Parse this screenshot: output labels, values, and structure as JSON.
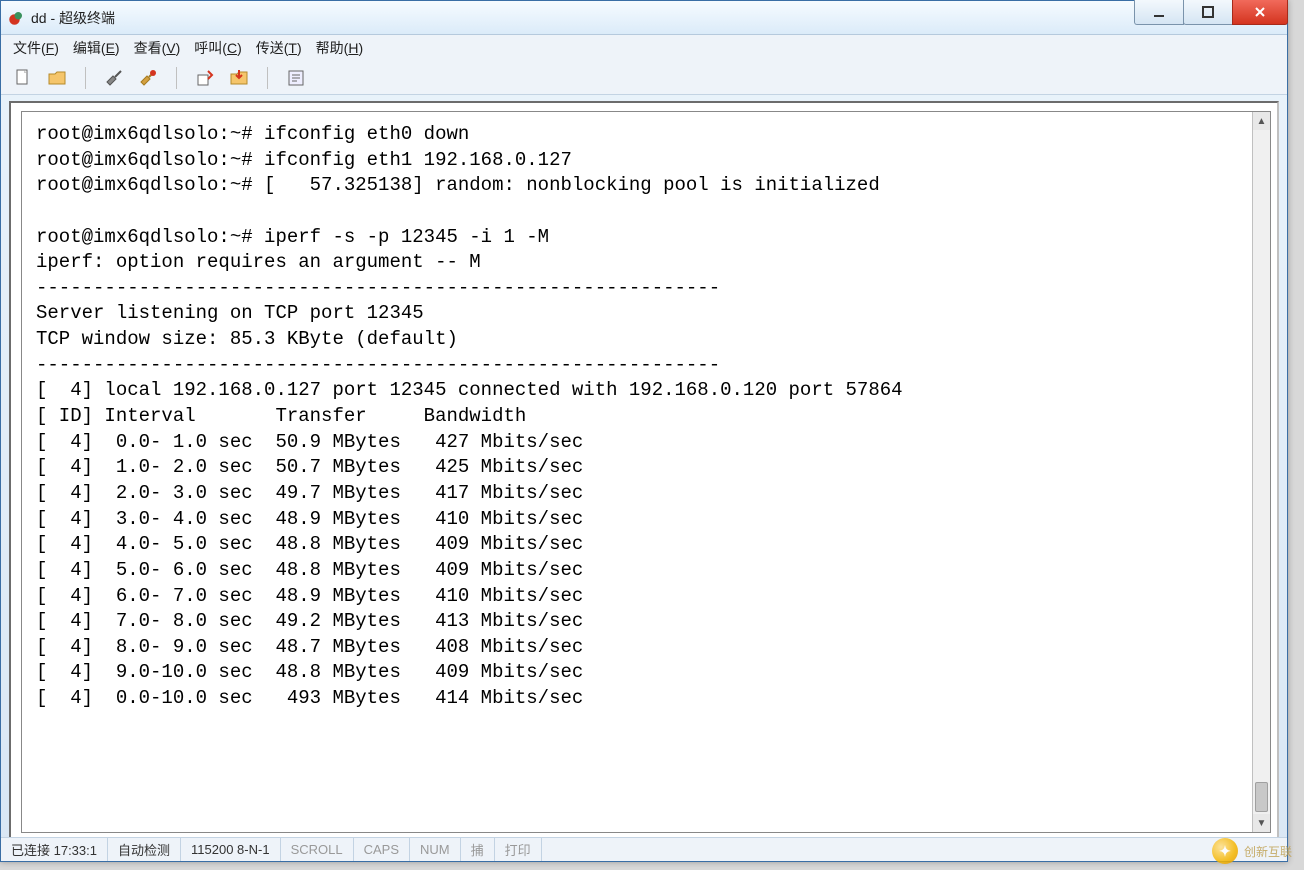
{
  "window": {
    "title": "dd - 超级终端"
  },
  "menu": {
    "items": [
      {
        "label": "文件(F)",
        "underline_index": 3
      },
      {
        "label": "编辑(E)",
        "underline_index": 3
      },
      {
        "label": "查看(V)",
        "underline_index": 3
      },
      {
        "label": "呼叫(C)",
        "underline_index": 3
      },
      {
        "label": "传送(T)",
        "underline_index": 3
      },
      {
        "label": "帮助(H)",
        "underline_index": 3
      }
    ]
  },
  "toolbar": {
    "icons": [
      "new-doc",
      "open",
      "connect",
      "disconnect",
      "send",
      "receive",
      "properties"
    ]
  },
  "terminal": {
    "lines": [
      "root@imx6qdlsolo:~# ifconfig eth0 down",
      "root@imx6qdlsolo:~# ifconfig eth1 192.168.0.127",
      "root@imx6qdlsolo:~# [   57.325138] random: nonblocking pool is initialized",
      "",
      "root@imx6qdlsolo:~# iperf -s -p 12345 -i 1 -M",
      "iperf: option requires an argument -- M",
      "------------------------------------------------------------",
      "Server listening on TCP port 12345",
      "TCP window size: 85.3 KByte (default)",
      "------------------------------------------------------------",
      "[  4] local 192.168.0.127 port 12345 connected with 192.168.0.120 port 57864",
      "[ ID] Interval       Transfer     Bandwidth",
      "[  4]  0.0- 1.0 sec  50.9 MBytes   427 Mbits/sec",
      "[  4]  1.0- 2.0 sec  50.7 MBytes   425 Mbits/sec",
      "[  4]  2.0- 3.0 sec  49.7 MBytes   417 Mbits/sec",
      "[  4]  3.0- 4.0 sec  48.9 MBytes   410 Mbits/sec",
      "[  4]  4.0- 5.0 sec  48.8 MBytes   409 Mbits/sec",
      "[  4]  5.0- 6.0 sec  48.8 MBytes   409 Mbits/sec",
      "[  4]  6.0- 7.0 sec  48.9 MBytes   410 Mbits/sec",
      "[  4]  7.0- 8.0 sec  49.2 MBytes   413 Mbits/sec",
      "[  4]  8.0- 9.0 sec  48.7 MBytes   408 Mbits/sec",
      "[  4]  9.0-10.0 sec  48.8 MBytes   409 Mbits/sec",
      "[  4]  0.0-10.0 sec   493 MBytes   414 Mbits/sec"
    ]
  },
  "status": {
    "connected": "已连接 17:33:1",
    "auto_detect": "自动检测",
    "serial": "115200 8-N-1",
    "scroll": "SCROLL",
    "caps": "CAPS",
    "num": "NUM",
    "capture": "捕",
    "print": "打印"
  },
  "watermark": {
    "text": "创新互联"
  }
}
